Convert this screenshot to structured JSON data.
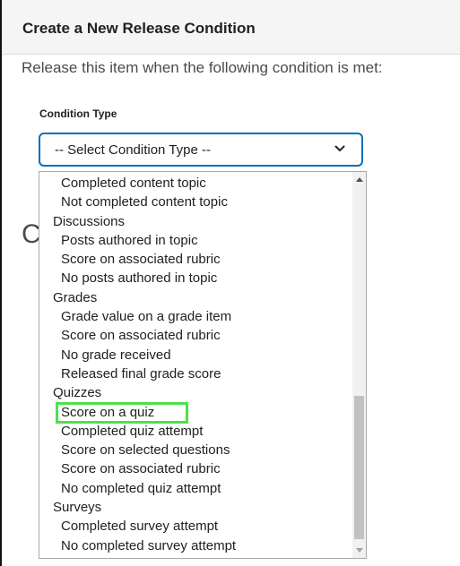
{
  "dialog": {
    "title": "Create a New Release Condition",
    "subtitle": "Release this item when the following condition is met:",
    "condition_type_label": "Condition Type",
    "background_glyph": "C"
  },
  "select": {
    "value": "-- Select Condition Type --",
    "chevron_icon": "chevron-down-icon"
  },
  "dropdown": {
    "options": [
      {
        "type": "option",
        "label": "Completed content topic"
      },
      {
        "type": "option",
        "label": "Not completed content topic"
      },
      {
        "type": "group",
        "label": "Discussions"
      },
      {
        "type": "option",
        "label": "Posts authored in topic"
      },
      {
        "type": "option",
        "label": "Score on associated rubric"
      },
      {
        "type": "option",
        "label": "No posts authored in topic"
      },
      {
        "type": "group",
        "label": "Grades"
      },
      {
        "type": "option",
        "label": "Grade value on a grade item"
      },
      {
        "type": "option",
        "label": "Score on associated rubric"
      },
      {
        "type": "option",
        "label": "No grade received"
      },
      {
        "type": "option",
        "label": "Released final grade score"
      },
      {
        "type": "group",
        "label": "Quizzes"
      },
      {
        "type": "option",
        "label": "Score on a quiz",
        "highlighted": true
      },
      {
        "type": "option",
        "label": "Completed quiz attempt"
      },
      {
        "type": "option",
        "label": "Score on selected questions"
      },
      {
        "type": "option",
        "label": "Score on associated rubric"
      },
      {
        "type": "option",
        "label": "No completed quiz attempt"
      },
      {
        "type": "group",
        "label": "Surveys"
      },
      {
        "type": "option",
        "label": "Completed survey attempt"
      },
      {
        "type": "option",
        "label": "No completed survey attempt"
      }
    ],
    "highlight_color": "#4ee04b"
  },
  "colors": {
    "accent": "#006fbf",
    "header_bg": "#f5f5f5"
  }
}
